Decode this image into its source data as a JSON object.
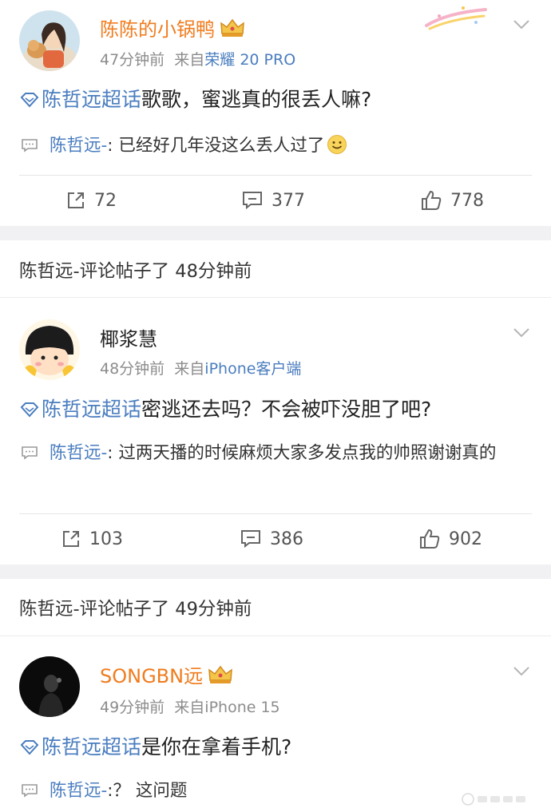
{
  "colors": {
    "link": "#4a7dbf",
    "vip_name": "#f07c1e",
    "meta": "#8c8c8c",
    "band": "#f1f1f3"
  },
  "posts": [
    {
      "username": "陈陈的小锅鸭",
      "time": "47分钟前",
      "source_prefix": "来自",
      "source": "荣耀 20 PRO",
      "topic": "陈哲远超话",
      "text": "歌歌，蜜逃真的很丢人嘛?",
      "reply_name": "陈哲远-",
      "reply_text": ": 已经好几年没这么丢人过了",
      "reply_emoji": "smile-emoji",
      "repost_count": "72",
      "comment_count": "377",
      "like_count": "778"
    },
    {
      "username": "椰浆慧",
      "time": "48分钟前",
      "source_prefix": "来自",
      "source": "iPhone客户端",
      "topic": "陈哲远超话",
      "text": "密逃还去吗？不会被吓没胆了吧?",
      "reply_name": "陈哲远-",
      "reply_text": ": 过两天播的时候麻烦大家多发点我的帅照谢谢真的",
      "repost_count": "103",
      "comment_count": "386",
      "like_count": "902"
    },
    {
      "username": "SONGBN远",
      "time": "49分钟前",
      "source_prefix": "来自",
      "source": "iPhone 15",
      "topic": "陈哲远超话",
      "text": "是你在拿着手机?",
      "reply_name": "陈哲远-",
      "reply_text": ":？ 这问题"
    }
  ],
  "notices": [
    {
      "text": "陈哲远-评论帖子了 48分钟前"
    },
    {
      "text": "陈哲远-评论帖子了 49分钟前"
    }
  ],
  "icons": [
    "crown-icon",
    "chevron-down-icon",
    "topic-diamond-icon",
    "reply-bubble-icon",
    "repost-icon",
    "comment-icon",
    "like-icon"
  ]
}
